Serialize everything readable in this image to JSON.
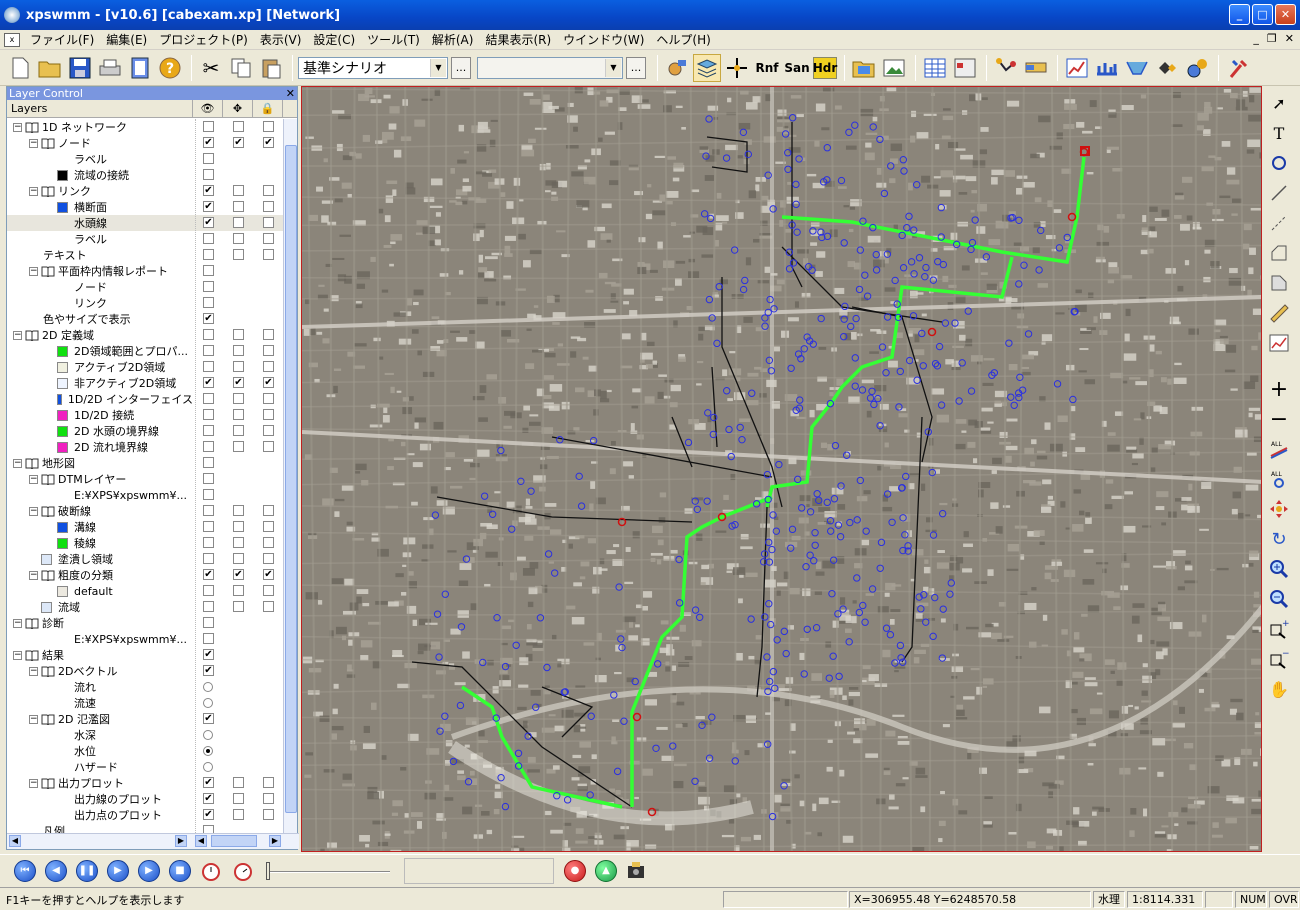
{
  "window": {
    "title": "xpswmm - [v10.6] [cabexam.xp] [Network]"
  },
  "menu": [
    "ファイル(F)",
    "編集(E)",
    "プロジェクト(P)",
    "表示(V)",
    "設定(C)",
    "ツール(T)",
    "解析(A)",
    "結果表示(R)",
    "ウインドウ(W)",
    "ヘルプ(H)"
  ],
  "toolbar": {
    "scenario": "基準シナリオ",
    "ellipsis": "...",
    "rnf": "Rnf",
    "san": "San",
    "hdr": "Hdr"
  },
  "layer_panel": {
    "title": "Layer Control",
    "col_layers": "Layers",
    "rows": [
      {
        "label": "1D ネットワーク",
        "level": 0,
        "kind": "book",
        "c": [
          0,
          0,
          0
        ]
      },
      {
        "label": "ノード",
        "level": 1,
        "kind": "book",
        "c": [
          1,
          1,
          1
        ]
      },
      {
        "label": "ラベル",
        "level": 2,
        "kind": "none",
        "c": [
          0
        ]
      },
      {
        "label": "流域の接続",
        "level": 2,
        "kind": "swatch",
        "color": "#000000",
        "c": [
          0
        ]
      },
      {
        "label": "リンク",
        "level": 1,
        "kind": "book",
        "c": [
          1,
          0,
          0
        ]
      },
      {
        "label": "横断面",
        "level": 2,
        "kind": "swatch",
        "color": "#1050e0",
        "c": [
          1,
          0,
          0
        ]
      },
      {
        "label": "水頭線",
        "level": 2,
        "kind": "none",
        "sel": true,
        "c": [
          1,
          0,
          0
        ]
      },
      {
        "label": "ラベル",
        "level": 2,
        "kind": "none",
        "c": [
          0,
          0,
          0
        ]
      },
      {
        "label": "テキスト",
        "level": 1,
        "kind": "none",
        "c": [
          0,
          0,
          0
        ]
      },
      {
        "label": "平面枠内情報レポート",
        "level": 1,
        "kind": "book",
        "c": [
          0
        ]
      },
      {
        "label": "ノード",
        "level": 2,
        "kind": "none",
        "c": [
          0
        ]
      },
      {
        "label": "リンク",
        "level": 2,
        "kind": "none",
        "c": [
          0
        ]
      },
      {
        "label": "色やサイズで表示",
        "level": 1,
        "kind": "none",
        "c": [
          1
        ]
      },
      {
        "label": "2D 定義域",
        "level": 0,
        "kind": "book",
        "c": [
          0,
          0,
          0
        ]
      },
      {
        "label": "2D領域範囲とプロパ...",
        "level": 2,
        "kind": "swatch",
        "color": "#10e010",
        "c": [
          0,
          0,
          0
        ]
      },
      {
        "label": "アクティブ2D領域",
        "level": 2,
        "kind": "swatch",
        "color": "#f0f0e0",
        "c": [
          0,
          0,
          0
        ]
      },
      {
        "label": "非アクティブ2D領域",
        "level": 2,
        "kind": "swatch",
        "color": "#eef4ff",
        "c": [
          1,
          1,
          1
        ]
      },
      {
        "label": "1D/2D インターフェイス",
        "level": 2,
        "kind": "swatch",
        "color": "#1050e0",
        "c": [
          0,
          0,
          0
        ]
      },
      {
        "label": "1D/2D 接続",
        "level": 2,
        "kind": "swatch",
        "color": "#f020c0",
        "c": [
          0,
          0,
          0
        ]
      },
      {
        "label": "2D 水頭の境界線",
        "level": 2,
        "kind": "swatch",
        "color": "#10e010",
        "c": [
          0,
          0,
          0
        ]
      },
      {
        "label": "2D 流れ境界線",
        "level": 2,
        "kind": "swatch",
        "color": "#f020c0",
        "c": [
          0,
          0,
          0
        ]
      },
      {
        "label": "地形図",
        "level": 0,
        "kind": "book",
        "c": [
          0
        ]
      },
      {
        "label": "DTMレイヤー",
        "level": 1,
        "kind": "book",
        "c": [
          0
        ]
      },
      {
        "label": "E:¥XPS¥xpswmm¥...",
        "level": 2,
        "kind": "none",
        "c": [
          0
        ]
      },
      {
        "label": "破断線",
        "level": 1,
        "kind": "book",
        "c": [
          0,
          0,
          0
        ]
      },
      {
        "label": "溝線",
        "level": 2,
        "kind": "swatch",
        "color": "#1050e0",
        "c": [
          0,
          0,
          0
        ]
      },
      {
        "label": "稜線",
        "level": 2,
        "kind": "swatch",
        "color": "#10e010",
        "c": [
          0,
          0,
          0
        ]
      },
      {
        "label": "塗潰し領域",
        "level": 1,
        "kind": "swatch",
        "color": "#dde8f8",
        "c": [
          0,
          0,
          0
        ]
      },
      {
        "label": "粗度の分類",
        "level": 1,
        "kind": "book",
        "c": [
          1,
          1,
          1
        ]
      },
      {
        "label": "default",
        "level": 2,
        "kind": "swatch",
        "color": "#ece9e0",
        "c": [
          0,
          0,
          0
        ]
      },
      {
        "label": "流域",
        "level": 1,
        "kind": "swatch",
        "color": "#dde8f8",
        "c": [
          0,
          0,
          0
        ]
      },
      {
        "label": "診断",
        "level": 0,
        "kind": "book",
        "c": [
          0
        ]
      },
      {
        "label": "E:¥XPS¥xpswmm¥...",
        "level": 2,
        "kind": "none",
        "c": [
          0
        ]
      },
      {
        "label": "結果",
        "level": 0,
        "kind": "book",
        "c": [
          1
        ]
      },
      {
        "label": "2Dベクトル",
        "level": 1,
        "kind": "book",
        "c": [
          1
        ]
      },
      {
        "label": "流れ",
        "level": 2,
        "kind": "none",
        "r": 0
      },
      {
        "label": "流速",
        "level": 2,
        "kind": "none",
        "r": 0
      },
      {
        "label": "2D 氾濫図",
        "level": 1,
        "kind": "book",
        "c": [
          1
        ]
      },
      {
        "label": "水深",
        "level": 2,
        "kind": "none",
        "r": 0
      },
      {
        "label": "水位",
        "level": 2,
        "kind": "none",
        "r": 1
      },
      {
        "label": "ハザード",
        "level": 2,
        "kind": "none",
        "r": 0
      },
      {
        "label": "出力プロット",
        "level": 1,
        "kind": "book",
        "c": [
          1,
          0,
          0
        ]
      },
      {
        "label": "出力線のプロット",
        "level": 2,
        "kind": "none",
        "c": [
          1,
          0,
          0
        ]
      },
      {
        "label": "出力点のプロット",
        "level": 2,
        "kind": "none",
        "c": [
          1,
          0,
          0
        ]
      },
      {
        "label": "凡例",
        "level": 1,
        "kind": "none",
        "c": [
          0
        ]
      }
    ]
  },
  "status": {
    "help": "F1キーを押すとヘルプを表示します",
    "coords": "X=306955.48     Y=6248570.58",
    "mode": "水理",
    "scale": "1:8114.331",
    "num": "NUM",
    "ovr": "OVR"
  },
  "colors": {
    "accent": "#0a5fe0",
    "network_node": "#2a30e0",
    "flow_line": "#30ff30",
    "error_node": "#d01010"
  }
}
